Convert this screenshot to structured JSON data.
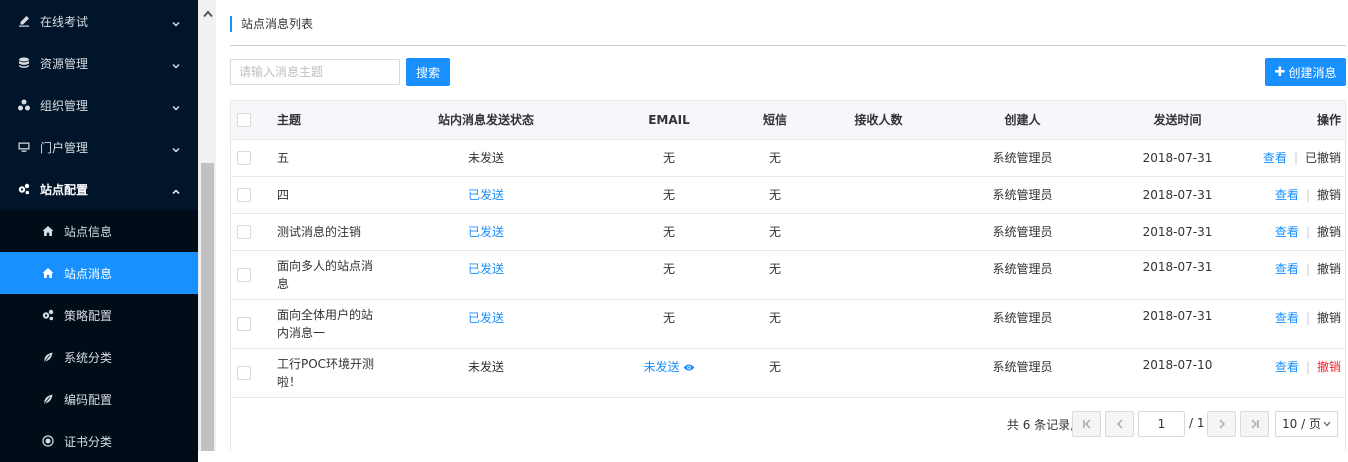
{
  "sidebar": {
    "items": [
      {
        "label": "在线考试",
        "icon": "edit-icon",
        "expanded": false
      },
      {
        "label": "资源管理",
        "icon": "database-icon",
        "expanded": false
      },
      {
        "label": "组织管理",
        "icon": "org-icon",
        "expanded": false
      },
      {
        "label": "门户管理",
        "icon": "monitor-icon",
        "expanded": false
      },
      {
        "label": "站点配置",
        "icon": "gears-icon",
        "expanded": true
      }
    ],
    "subitems": [
      {
        "label": "站点信息",
        "icon": "home-icon"
      },
      {
        "label": "站点消息",
        "icon": "home-icon",
        "active": true
      },
      {
        "label": "策略配置",
        "icon": "gears-icon"
      },
      {
        "label": "系统分类",
        "icon": "leaf-icon"
      },
      {
        "label": "编码配置",
        "icon": "leaf-icon"
      },
      {
        "label": "证书分类",
        "icon": "cert-icon"
      }
    ]
  },
  "page": {
    "title": "站点消息列表"
  },
  "toolbar": {
    "search_placeholder": "请输入消息主题",
    "search_value": "",
    "search_label": "搜索",
    "create_label": "创建消息"
  },
  "table": {
    "headers": {
      "subject": "主题",
      "status": "站内消息发送状态",
      "email": "EMAIL",
      "sms": "短信",
      "recipients": "接收人数",
      "creator": "创建人",
      "time": "发送时间",
      "ops": "操作"
    },
    "rows": [
      {
        "subject": "五",
        "status": "未发送",
        "email": "无",
        "sms": "无",
        "recipients": "",
        "creator": "系统管理员",
        "time": "2018-07-31",
        "view": "查看",
        "action": "已撤销"
      },
      {
        "subject": "四",
        "status": "已发送",
        "email": "无",
        "sms": "无",
        "recipients": "",
        "creator": "系统管理员",
        "time": "2018-07-31",
        "view": "查看",
        "action": "撤销"
      },
      {
        "subject": "测试消息的注销",
        "status": "已发送",
        "email": "无",
        "sms": "无",
        "recipients": "",
        "creator": "系统管理员",
        "time": "2018-07-31",
        "view": "查看",
        "action": "撤销"
      },
      {
        "subject": "面向多人的站点消息",
        "status": "已发送",
        "email": "无",
        "sms": "无",
        "recipients": "",
        "creator": "系统管理员",
        "time": "2018-07-31",
        "view": "查看",
        "action": "撤销"
      },
      {
        "subject": "面向全体用户的站内消息一",
        "status": "已发送",
        "email": "无",
        "sms": "无",
        "recipients": "",
        "creator": "系统管理员",
        "time": "2018-07-31",
        "view": "查看",
        "action": "撤销"
      },
      {
        "subject": "工行POC环境开测啦！",
        "status": "未发送",
        "email": "未发送",
        "sms": "无",
        "recipients": "",
        "creator": "系统管理员",
        "time": "2018-07-10",
        "view": "查看",
        "action": "撤销"
      }
    ]
  },
  "pagination": {
    "total_text": "共 6 条记录,",
    "current_page": "1",
    "total_pages": "/ 1",
    "page_size": "10 / 页"
  },
  "colors": {
    "primary": "#1890ff",
    "danger": "#f5222d",
    "sidebar_bg": "#001529"
  }
}
